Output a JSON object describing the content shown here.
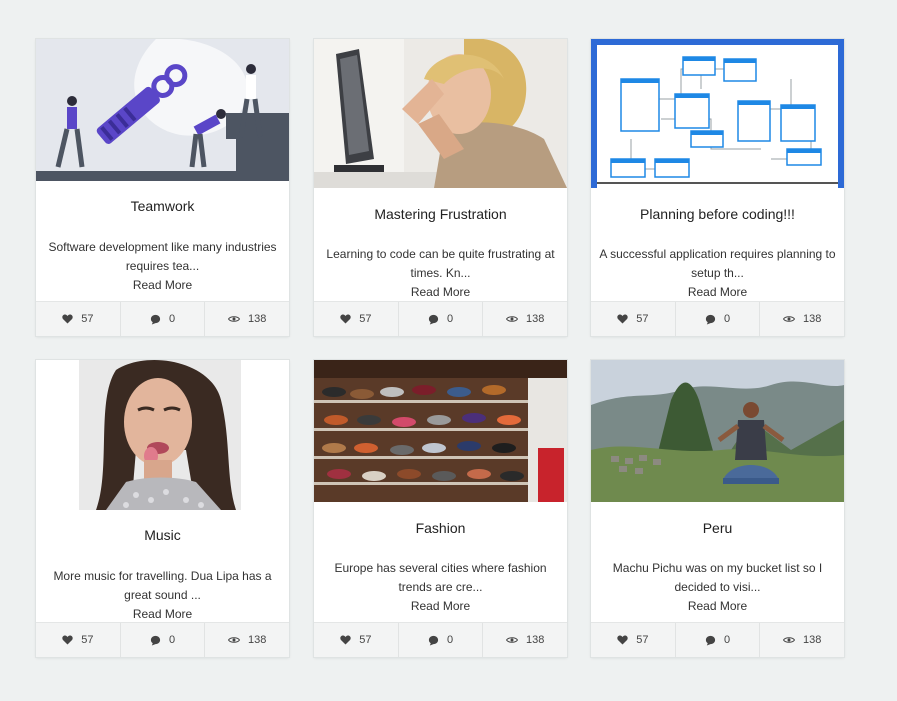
{
  "colors": {
    "background": "#eef1f1",
    "footer": "#f3f4f4",
    "accent": "#1976d2"
  },
  "stat_icons": [
    "heart-icon",
    "comment-icon",
    "eye-icon"
  ],
  "posts": [
    {
      "title": "Teamwork",
      "excerpt": "Software development like many industries requires tea...",
      "read_more": "Read More",
      "likes": "57",
      "comments": "0",
      "views": "138",
      "image": "teamwork-illustration"
    },
    {
      "title": "Mastering Frustration",
      "excerpt": "Learning to code can be quite frustrating at times. Kn...",
      "read_more": "Read More",
      "likes": "57",
      "comments": "0",
      "views": "138",
      "image": "frustrated-woman-at-computer-photo"
    },
    {
      "title": "Planning before coding!!!",
      "excerpt": "A successful application requires planning to setup th...",
      "read_more": "Read More",
      "likes": "57",
      "comments": "0",
      "views": "138",
      "image": "database-schema-diagram"
    },
    {
      "title": "Music",
      "excerpt": "More music for travelling. Dua Lipa has a great sound ...",
      "read_more": "Read More",
      "likes": "57",
      "comments": "0",
      "views": "138",
      "image": "singer-portrait-photo"
    },
    {
      "title": "Fashion",
      "excerpt": "Europe has several cities where fashion trends are cre...",
      "read_more": "Read More",
      "likes": "57",
      "comments": "0",
      "views": "138",
      "image": "shoe-store-shelves-photo"
    },
    {
      "title": "Peru",
      "excerpt": "Machu Pichu was on my bucket list so I decided to visi...",
      "read_more": "Read More",
      "likes": "57",
      "comments": "0",
      "views": "138",
      "image": "machu-picchu-photo"
    }
  ]
}
